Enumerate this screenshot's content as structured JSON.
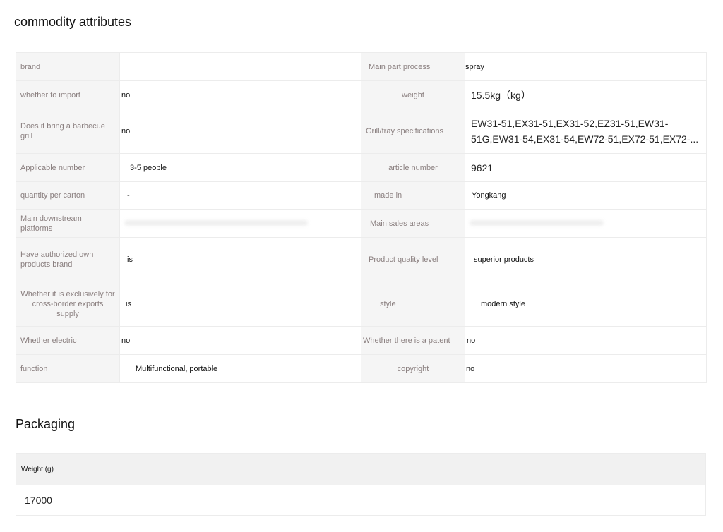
{
  "commodity_attributes": {
    "title": "commodity attributes",
    "rows": [
      {
        "k1": "brand",
        "v1": "",
        "k2": "Main part process",
        "v2": "spray"
      },
      {
        "k1": "whether to import",
        "v1": "no",
        "k2": "weight",
        "v2": "15.5kg（kg）"
      },
      {
        "k1": "Does it bring a barbecue grill",
        "v1": "no",
        "k2": "Grill/tray specifications",
        "v2": "EW31-51,EX31-51,EX31-52,EZ31-51,EW31-51G,EW31-54,EX31-54,EW72-51,EX72-51,EX72-..."
      },
      {
        "k1": "Applicable number",
        "v1": "3-5 people",
        "k2": "article number",
        "v2": "9621"
      },
      {
        "k1": "quantity per carton",
        "v1": "-",
        "k2": "made in",
        "v2": "Yongkang"
      },
      {
        "k1": "Main downstream platforms",
        "v1": "",
        "k2": "Main sales areas",
        "v2": ""
      },
      {
        "k1": "Have authorized own products brand",
        "v1": "is",
        "k2": "Product quality level",
        "v2": "superior products"
      },
      {
        "k1": "Whether it is exclusively for cross-border exports supply",
        "v1": "is",
        "k2": "style",
        "v2": "modern style"
      },
      {
        "k1": "Whether electric",
        "v1": "no",
        "k2": "Whether there is a patent",
        "v2": "no"
      },
      {
        "k1": "function",
        "v1": "Multifunctional, portable",
        "k2": "copyright",
        "v2": "no"
      }
    ]
  },
  "packaging": {
    "title": "Packaging",
    "columns": [
      "Weight (g)"
    ],
    "rows": [
      [
        "17000"
      ]
    ]
  }
}
